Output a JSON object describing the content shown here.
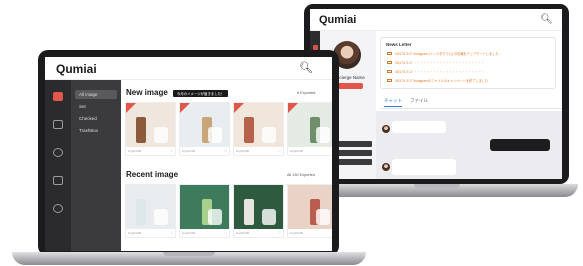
{
  "back": {
    "logo": "Qumiai",
    "profile_name": "Concierge Name",
    "news_title": "News Letter",
    "news_items": [
      "03/17/1 9:17  Instagram (インスタグラム) の情報をアップデートしました・",
      "03/17/1 9:17  ・・・・・・・・・・・・・・・・・・・・・・",
      "03/17/1 9:17  ・・・・・・・・・・・・・・・・・・・・・・",
      "03/17/1 9:17  Instagramのファイルのキャンペーンを終了しました"
    ],
    "tabs": [
      "チャット",
      "ファイル"
    ]
  },
  "front": {
    "logo": "Qumiai",
    "nav": [
      {
        "label": "All image",
        "active": true
      },
      {
        "label": "Set",
        "active": false
      },
      {
        "label": "Checked",
        "active": false
      },
      {
        "label": "TrashBox",
        "active": false
      }
    ],
    "new_section": {
      "title": "New image",
      "tag": "今月のイメージが届きました！",
      "count": "6 Exported"
    },
    "recent_section": {
      "title": "Recent image",
      "count": "All 130 Exported"
    },
    "new_cards": [
      {
        "meta": "img/01/00",
        "bg": "#efe7de",
        "accent": "#8a5a3a"
      },
      {
        "meta": "img/01/00",
        "bg": "#e8eef0",
        "accent": "#c9a57a"
      },
      {
        "meta": "img/01/00",
        "bg": "#f1e6dc",
        "accent": "#b7604a"
      },
      {
        "meta": "img/01/00",
        "bg": "#e4ebe5",
        "accent": "#6f8f6a"
      }
    ],
    "recent_cards": [
      {
        "meta": "img/01/00",
        "bg": "#e8ecee",
        "accent": "#dfe8e8"
      },
      {
        "meta": "img/01/00",
        "bg": "#3e7a5c",
        "accent": "#a8d08c"
      },
      {
        "meta": "img/01/00",
        "bg": "#2e5a40",
        "accent": "#e8e4df"
      },
      {
        "meta": "img/01/00",
        "bg": "#e9d3c6",
        "accent": "#b95d4e"
      }
    ]
  }
}
